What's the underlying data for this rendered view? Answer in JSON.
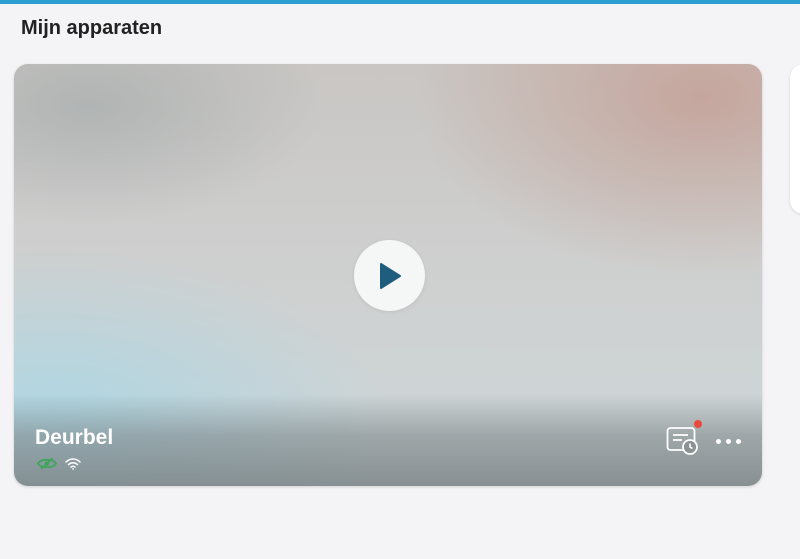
{
  "header": {
    "title": "Mijn apparaten"
  },
  "device": {
    "name": "Deurbel",
    "has_notification": true,
    "colors": {
      "accent": "#2a9fd0",
      "notification": "#e84a3e",
      "play_icon": "#1f5d7e",
      "status_eye": "#3ea55a"
    },
    "icons": {
      "play": "play-icon",
      "status_privacy": "eye-off-icon",
      "status_connection": "wifi-icon",
      "history": "event-history-icon",
      "more": "more-horizontal-icon"
    }
  }
}
